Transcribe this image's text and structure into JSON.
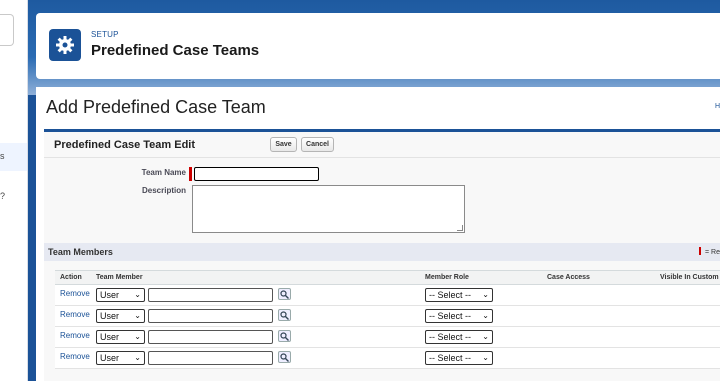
{
  "sidebar": {
    "selected_item_fragment": "s",
    "question_fragment": "?"
  },
  "header": {
    "eyebrow": "SETUP",
    "title": "Predefined Case Teams"
  },
  "page": {
    "title": "Add Predefined Case Team",
    "help_fragment": "H"
  },
  "edit_block": {
    "title": "Predefined Case Team Edit",
    "save_label": "Save",
    "cancel_label": "Cancel",
    "team_name_label": "Team Name",
    "team_name_value": "",
    "description_label": "Description",
    "description_value": ""
  },
  "members": {
    "section_title": "Team Members",
    "required_legend": "= Re",
    "columns": [
      "Action",
      "Team Member",
      "Member Role",
      "Case Access",
      "Visible In Custom"
    ],
    "rows": [
      {
        "action": "Remove",
        "type": "User",
        "member": "",
        "role": "-- Select --"
      },
      {
        "action": "Remove",
        "type": "User",
        "member": "",
        "role": "-- Select --"
      },
      {
        "action": "Remove",
        "type": "User",
        "member": "",
        "role": "-- Select --"
      },
      {
        "action": "Remove",
        "type": "User",
        "member": "",
        "role": "-- Select --"
      }
    ]
  },
  "colors": {
    "brand": "#1b5297",
    "required": "#cc0000"
  }
}
